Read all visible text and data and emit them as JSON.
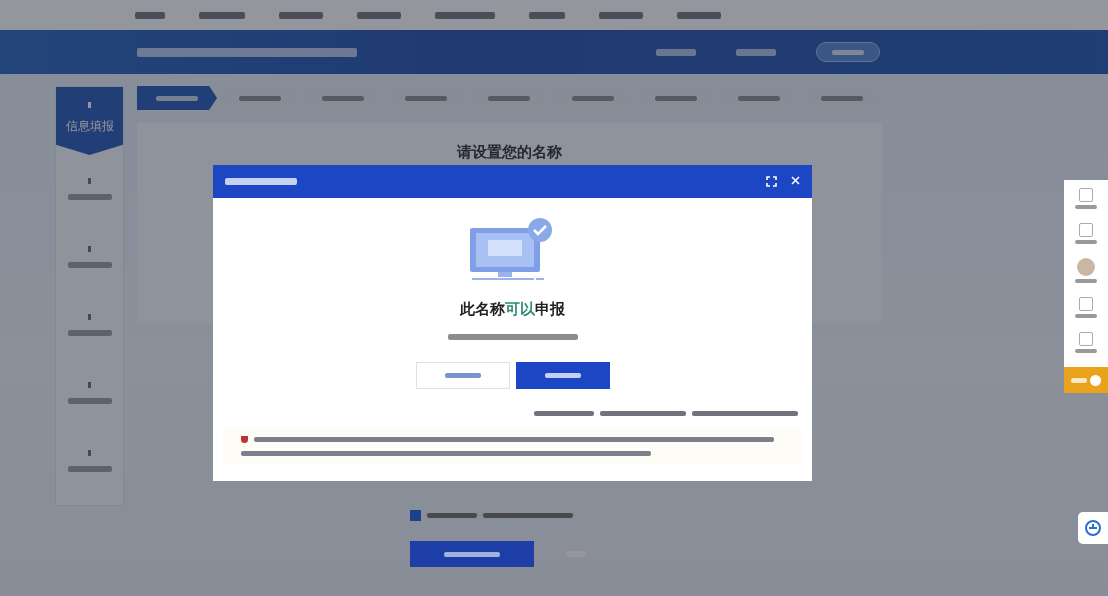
{
  "steps": [
    {
      "selected": true
    },
    {
      "selected": false
    },
    {
      "selected": false
    },
    {
      "selected": false
    },
    {
      "selected": false
    },
    {
      "selected": false
    },
    {
      "selected": false
    },
    {
      "selected": false
    },
    {
      "selected": false
    }
  ],
  "sidebar": {
    "items": [
      {
        "label": "信息填报",
        "selected": true
      },
      {
        "selected": false
      },
      {
        "selected": false
      },
      {
        "selected": false
      },
      {
        "selected": false
      },
      {
        "selected": false
      }
    ]
  },
  "content": {
    "heading": "请设置您的名称"
  },
  "dialog": {
    "result": {
      "before": "此名称",
      "highlight": "可以",
      "after": "申报"
    },
    "confirm_checked": true
  }
}
